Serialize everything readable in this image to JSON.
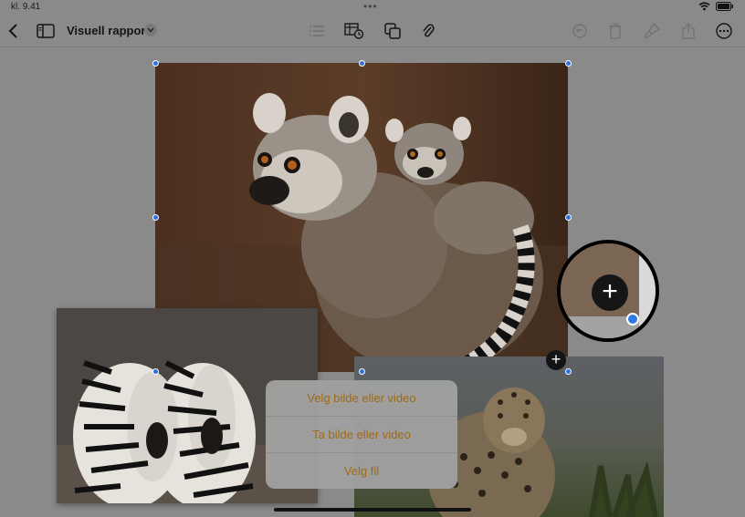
{
  "status_bar": {
    "time": "kl. 9.41",
    "dots": "•••"
  },
  "toolbar": {
    "title": "Visuell rapport",
    "left_icons": [
      "back-chevron-icon",
      "sidebar-icon"
    ],
    "center_icons": [
      "list-icon",
      "insert-table-chart-icon",
      "shapes-icon",
      "paperclip-icon"
    ],
    "right_icons": [
      "undo-icon",
      "delete-icon",
      "format-brush-icon",
      "share-icon",
      "more-icon"
    ]
  },
  "menu": {
    "items": [
      "Velg bilde eller video",
      "Ta bilde eller video",
      "Velg fil"
    ]
  },
  "plus_symbol": "+",
  "colors": {
    "accent": "#2f6fdf",
    "menu_text": "#a06a16"
  }
}
